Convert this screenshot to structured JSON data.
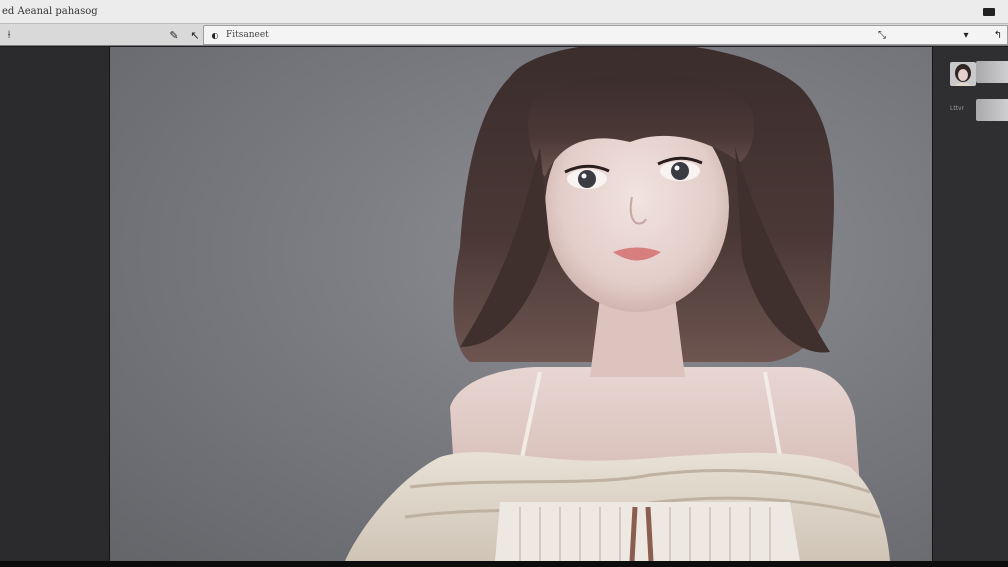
{
  "titlebar": {
    "title": "ed  Aeanal  pahasog"
  },
  "toolbar": {
    "tools": [
      {
        "name": "move-tool-icon",
        "glyph": "⟊"
      },
      {
        "name": "brush-tool-icon",
        "glyph": "✎"
      },
      {
        "name": "pen-tool-icon",
        "glyph": "↖"
      }
    ],
    "address": {
      "icon_glyph": "◐",
      "text": "Fitsaneet"
    },
    "right_tools": [
      {
        "name": "selection-tool-icon",
        "glyph": "⤡"
      },
      {
        "name": "dropdown-icon",
        "glyph": "▾"
      },
      {
        "name": "pin-tool-icon",
        "glyph": "↰"
      }
    ]
  },
  "layers_panel": {
    "layers": [
      {
        "label": ""
      },
      {
        "label": "Lttvr"
      }
    ]
  },
  "colors": {
    "canvas_bg": "#7a7b81",
    "panel_bg": "#2b2b2d",
    "menu_bg": "#ececec"
  }
}
